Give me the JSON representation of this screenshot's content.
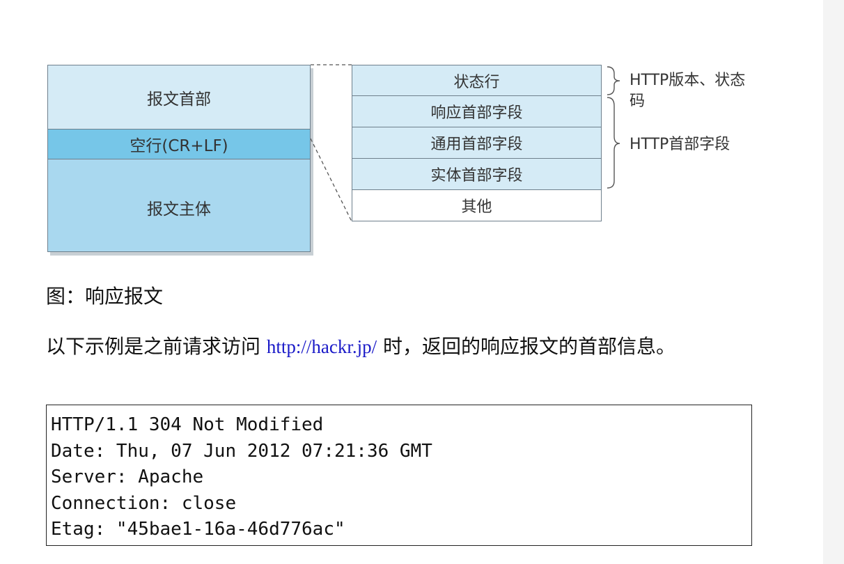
{
  "figure": {
    "left_stack": {
      "header": "报文首部",
      "blank_line": "空行(CR+LF)",
      "body": "报文主体"
    },
    "right_stack": [
      "状态行",
      "响应首部字段",
      "通用首部字段",
      "实体首部字段",
      "其他"
    ],
    "annotations": {
      "status_line_note": "HTTP版本、状态码",
      "header_fields_note": "HTTP首部字段"
    },
    "colors": {
      "header_fill": "#d5ebf6",
      "blank_line_fill": "#76c6e8",
      "body_fill": "#a9d8ef",
      "border": "#6e7f8c"
    }
  },
  "caption": "图：响应报文",
  "paragraph": {
    "before_link": "以下示例是之前请求访问 ",
    "link": "http://hackr.jp/",
    "after_link": " 时，返回的响应报文的首部信息。"
  },
  "code": {
    "lines": [
      "HTTP/1.1 304 Not Modified",
      "Date: Thu, 07 Jun 2012 07:21:36 GMT",
      "Server: Apache",
      "Connection: close",
      "Etag: \"45bae1-16a-46d776ac\""
    ]
  }
}
